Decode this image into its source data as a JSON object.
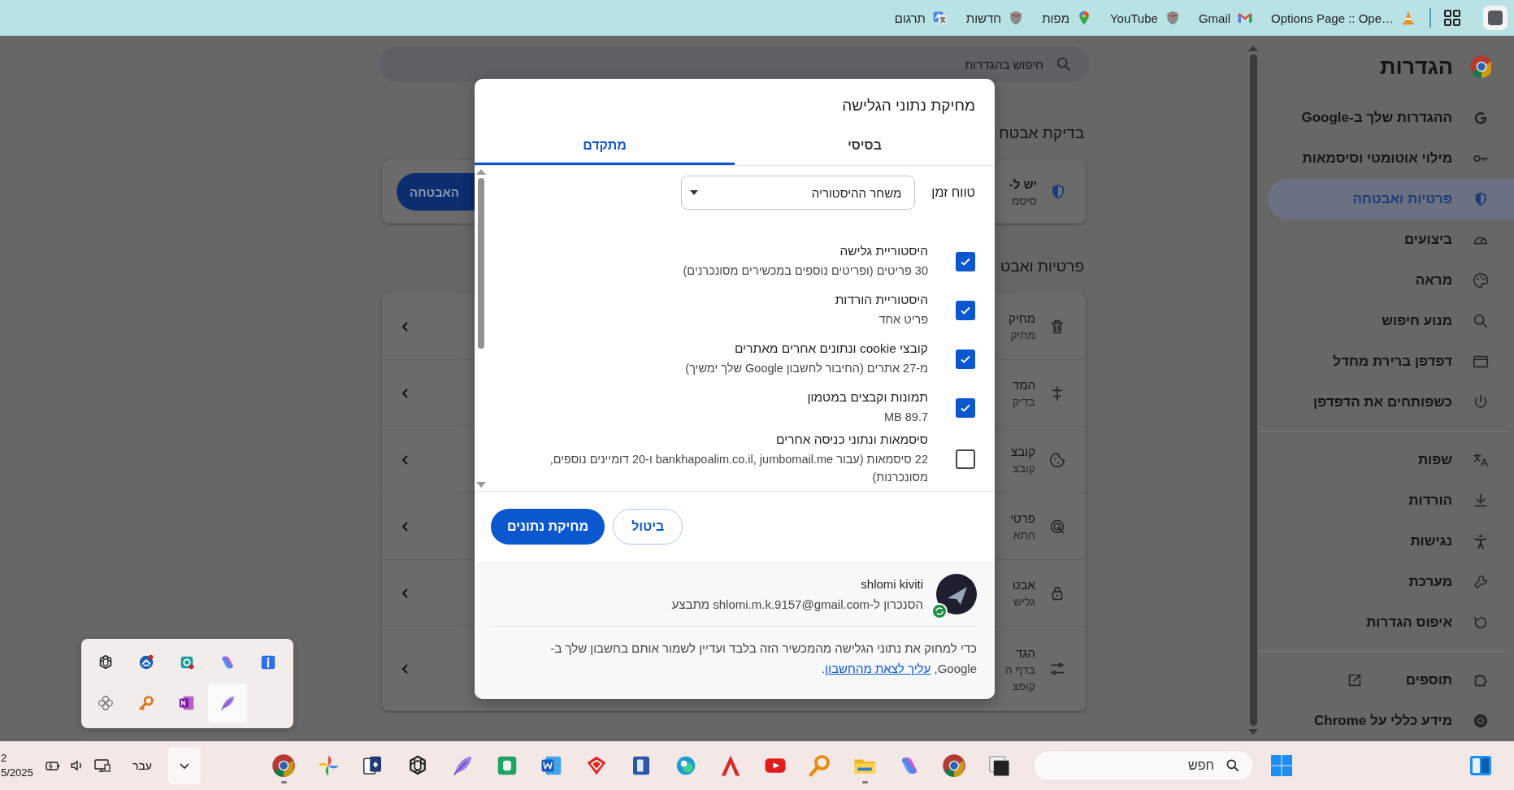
{
  "bookmarks_bar": {
    "items": [
      {
        "label": "Options Page :: Ope…"
      },
      {
        "label": "Gmail"
      },
      {
        "label": "YouTube"
      },
      {
        "label": "מפות"
      },
      {
        "label": "חדשות"
      },
      {
        "label": "תרגום"
      }
    ]
  },
  "settings": {
    "title": "הגדרות",
    "search": {
      "placeholder": "חיפוש בהגדרות"
    },
    "sidebar": {
      "groups": [
        {
          "items": [
            {
              "label": "ההגדרות שלך ב-Google",
              "selected": false,
              "external": false
            },
            {
              "label": "מילוי אוטומטי וסיסמאות",
              "selected": false,
              "external": false
            },
            {
              "label": "פרטיות ואבטחה",
              "selected": true,
              "external": false
            },
            {
              "label": "ביצועים",
              "selected": false,
              "external": false
            },
            {
              "label": "מראה",
              "selected": false,
              "external": false
            },
            {
              "label": "מנוע חיפוש",
              "selected": false,
              "external": false
            },
            {
              "label": "דפדפן ברירת מחדל",
              "selected": false,
              "external": false
            },
            {
              "label": "כשפותחים את הדפדפן",
              "selected": false,
              "external": false
            }
          ]
        },
        {
          "items": [
            {
              "label": "שפות",
              "selected": false,
              "external": false
            },
            {
              "label": "הורדות",
              "selected": false,
              "external": false
            },
            {
              "label": "נגישות",
              "selected": false,
              "external": false
            },
            {
              "label": "מערכת",
              "selected": false,
              "external": false
            },
            {
              "label": "איפוס הגדרות",
              "selected": false,
              "external": false
            }
          ]
        },
        {
          "items": [
            {
              "label": "תוספים",
              "selected": false,
              "external": true
            },
            {
              "label": "מידע כללי על Chrome",
              "selected": false,
              "external": false
            }
          ]
        }
      ]
    },
    "safety_check": {
      "heading": "בדיקת אבטח",
      "title": "יש ל-",
      "subtitle": "סיסמ",
      "button": "האבטחה"
    },
    "privacy": {
      "heading": "פרטיות ואבט",
      "rows": [
        {
          "lines": [
            "מחיק",
            "מחיק"
          ]
        },
        {
          "lines": [
            "המד",
            "בדיק"
          ]
        },
        {
          "lines": [
            "קובצ",
            "קובצ"
          ]
        },
        {
          "lines": [
            "פרטי",
            "התא"
          ]
        },
        {
          "lines": [
            "אבט",
            "גליש"
          ]
        },
        {
          "lines": [
            "הגד",
            "בדף ה",
            "קופצ"
          ]
        }
      ]
    }
  },
  "dialog": {
    "title": "מחיקת נתוני הגלישה",
    "tabs": [
      {
        "label": "בסיסי",
        "selected": false
      },
      {
        "label": "מתקדם",
        "selected": true
      }
    ],
    "time_range": {
      "label": "טווח זמן",
      "value": "משחר ההיסטוריה"
    },
    "options": [
      {
        "label": "היסטוריית גלישה",
        "detail": "30 פריטים (ופריטים נוספים במכשירים מסונכרנים)",
        "checked": true
      },
      {
        "label": "היסטוריית הורדות",
        "detail": "פריט אחד",
        "checked": true
      },
      {
        "label": "קובצי cookie ונתונים אחרים מאתרים",
        "detail": "מ-27 אתרים (החיבור לחשבון Google שלך ימשיך)",
        "checked": true
      },
      {
        "label": "תמונות וקבצים במטמון",
        "detail": "MB 89.7",
        "checked": true
      },
      {
        "label": "סיסמאות ונתוני כניסה אחרים",
        "detail": "22 סיסמאות (עבור bankhapoalim.co.il, jumbomail.me ו-20 דומיינים נוספים, מסונכרנות)",
        "checked": false
      }
    ],
    "buttons": {
      "cancel": "ביטול",
      "confirm": "מחיקת נתונים"
    },
    "account": {
      "name": "shlomi kiviti",
      "sync_status": "הסנכרון ל-shlomi.m.k.9157@gmail.com מתבצע"
    },
    "note": {
      "text": "כדי למחוק את נתוני הגלישה מהמכשיר הזה בלבד ועדיין לשמור אותם בחשבון שלך ב-Google,",
      "link": "עליך לצאת מהחשבון",
      "after": "."
    }
  },
  "tray_overflow": {
    "items": [
      {
        "selected": false
      },
      {
        "selected": false
      },
      {
        "selected": false
      },
      {
        "selected": false
      },
      {
        "selected": false
      },
      {
        "selected": false
      },
      {
        "selected": false
      },
      {
        "selected": false
      },
      {
        "selected": true
      }
    ]
  },
  "taskbar": {
    "clock": {
      "time": "2",
      "date": "5/2025"
    },
    "language": "עבר",
    "search": {
      "placeholder": "חפש"
    },
    "apps": [
      {
        "running": true
      },
      {
        "running": false
      },
      {
        "running": false
      },
      {
        "running": false
      },
      {
        "running": false
      },
      {
        "running": false
      },
      {
        "running": false
      },
      {
        "running": false
      },
      {
        "running": false
      },
      {
        "running": false
      },
      {
        "running": false
      },
      {
        "running": false
      },
      {
        "running": false
      },
      {
        "running": true
      },
      {
        "running": false
      },
      {
        "running": false
      },
      {
        "running": false
      }
    ]
  }
}
